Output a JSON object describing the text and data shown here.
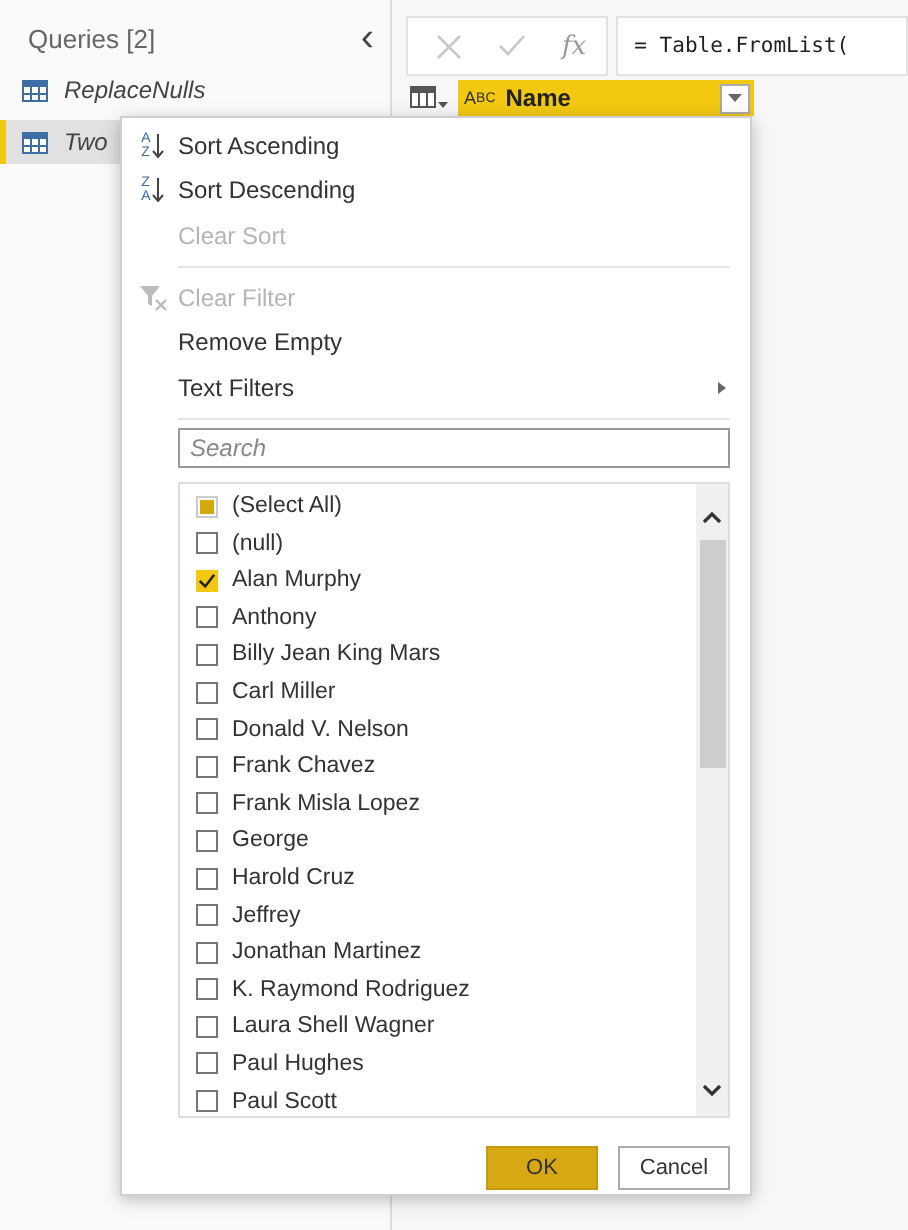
{
  "sidebar": {
    "title": "Queries [2]",
    "collapse_glyph": "‹",
    "items": [
      {
        "label": "ReplaceNulls",
        "selected": false
      },
      {
        "label": "Two",
        "selected": true
      }
    ]
  },
  "formula_bar": {
    "fx": "fx",
    "formula": "= Table.FromList("
  },
  "column_header": {
    "type_letters": [
      "A",
      "B",
      "C"
    ],
    "name": "Name"
  },
  "menu": {
    "items": [
      {
        "kind": "sort",
        "label": "Sort Ascending",
        "icon_letters": [
          "A",
          "Z"
        ],
        "disabled": false
      },
      {
        "kind": "sort",
        "label": "Sort Descending",
        "icon_letters": [
          "Z",
          "A"
        ],
        "disabled": false
      },
      {
        "kind": "plain",
        "label": "Clear Sort",
        "disabled": true
      },
      {
        "kind": "separator"
      },
      {
        "kind": "filter",
        "label": "Clear Filter",
        "disabled": true
      },
      {
        "kind": "plain",
        "label": "Remove Empty",
        "disabled": false
      },
      {
        "kind": "submenu",
        "label": "Text Filters",
        "disabled": false
      },
      {
        "kind": "separator"
      }
    ],
    "search": {
      "placeholder": "Search"
    },
    "values": [
      {
        "label": "(Select All)",
        "checked": false,
        "indeterminate": true
      },
      {
        "label": "(null)",
        "checked": false,
        "indeterminate": false
      },
      {
        "label": "Alan Murphy",
        "checked": true,
        "indeterminate": false
      },
      {
        "label": "Anthony",
        "checked": false,
        "indeterminate": false
      },
      {
        "label": "Billy Jean King Mars",
        "checked": false,
        "indeterminate": false
      },
      {
        "label": "Carl Miller",
        "checked": false,
        "indeterminate": false
      },
      {
        "label": "Donald V. Nelson",
        "checked": false,
        "indeterminate": false
      },
      {
        "label": "Frank Chavez",
        "checked": false,
        "indeterminate": false
      },
      {
        "label": "Frank Misla Lopez",
        "checked": false,
        "indeterminate": false
      },
      {
        "label": "George",
        "checked": false,
        "indeterminate": false
      },
      {
        "label": "Harold Cruz",
        "checked": false,
        "indeterminate": false
      },
      {
        "label": "Jeffrey",
        "checked": false,
        "indeterminate": false
      },
      {
        "label": "Jonathan Martinez",
        "checked": false,
        "indeterminate": false
      },
      {
        "label": "K. Raymond Rodriguez",
        "checked": false,
        "indeterminate": false
      },
      {
        "label": "Laura Shell Wagner",
        "checked": false,
        "indeterminate": false
      },
      {
        "label": "Paul Hughes",
        "checked": false,
        "indeterminate": false
      },
      {
        "label": "Paul Scott",
        "checked": false,
        "indeterminate": false
      }
    ],
    "buttons": [
      {
        "label": "OK",
        "primary": true
      },
      {
        "label": "Cancel",
        "primary": false
      }
    ]
  }
}
